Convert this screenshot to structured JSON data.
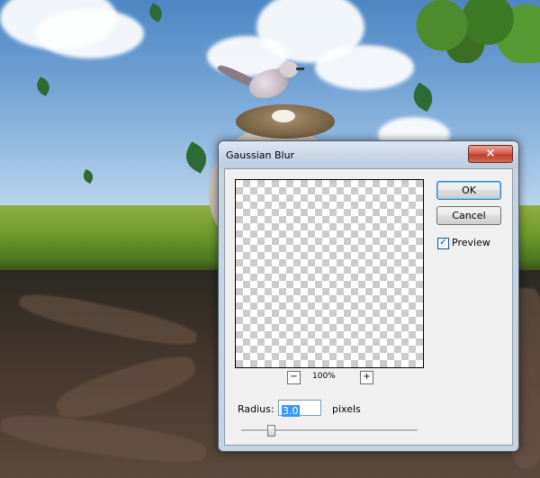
{
  "dialog": {
    "title": "Gaussian Blur",
    "close_icon": "×",
    "ok_label": "OK",
    "cancel_label": "Cancel",
    "preview_label": "Preview",
    "preview_checked": true,
    "checkmark": "✓",
    "zoom_minus": "−",
    "zoom_plus": "+",
    "zoom_level": "100%",
    "radius_label": "Radius:",
    "radius_value": "3.0",
    "units_label": "pixels",
    "slider_level": 0.17
  },
  "icons": {
    "close": "close-icon",
    "checkbox": "checkmark-icon"
  },
  "colors": {
    "close_button": "#c9452f",
    "selection": "#3399ff",
    "dialog_frame": "#c6d3e2"
  }
}
